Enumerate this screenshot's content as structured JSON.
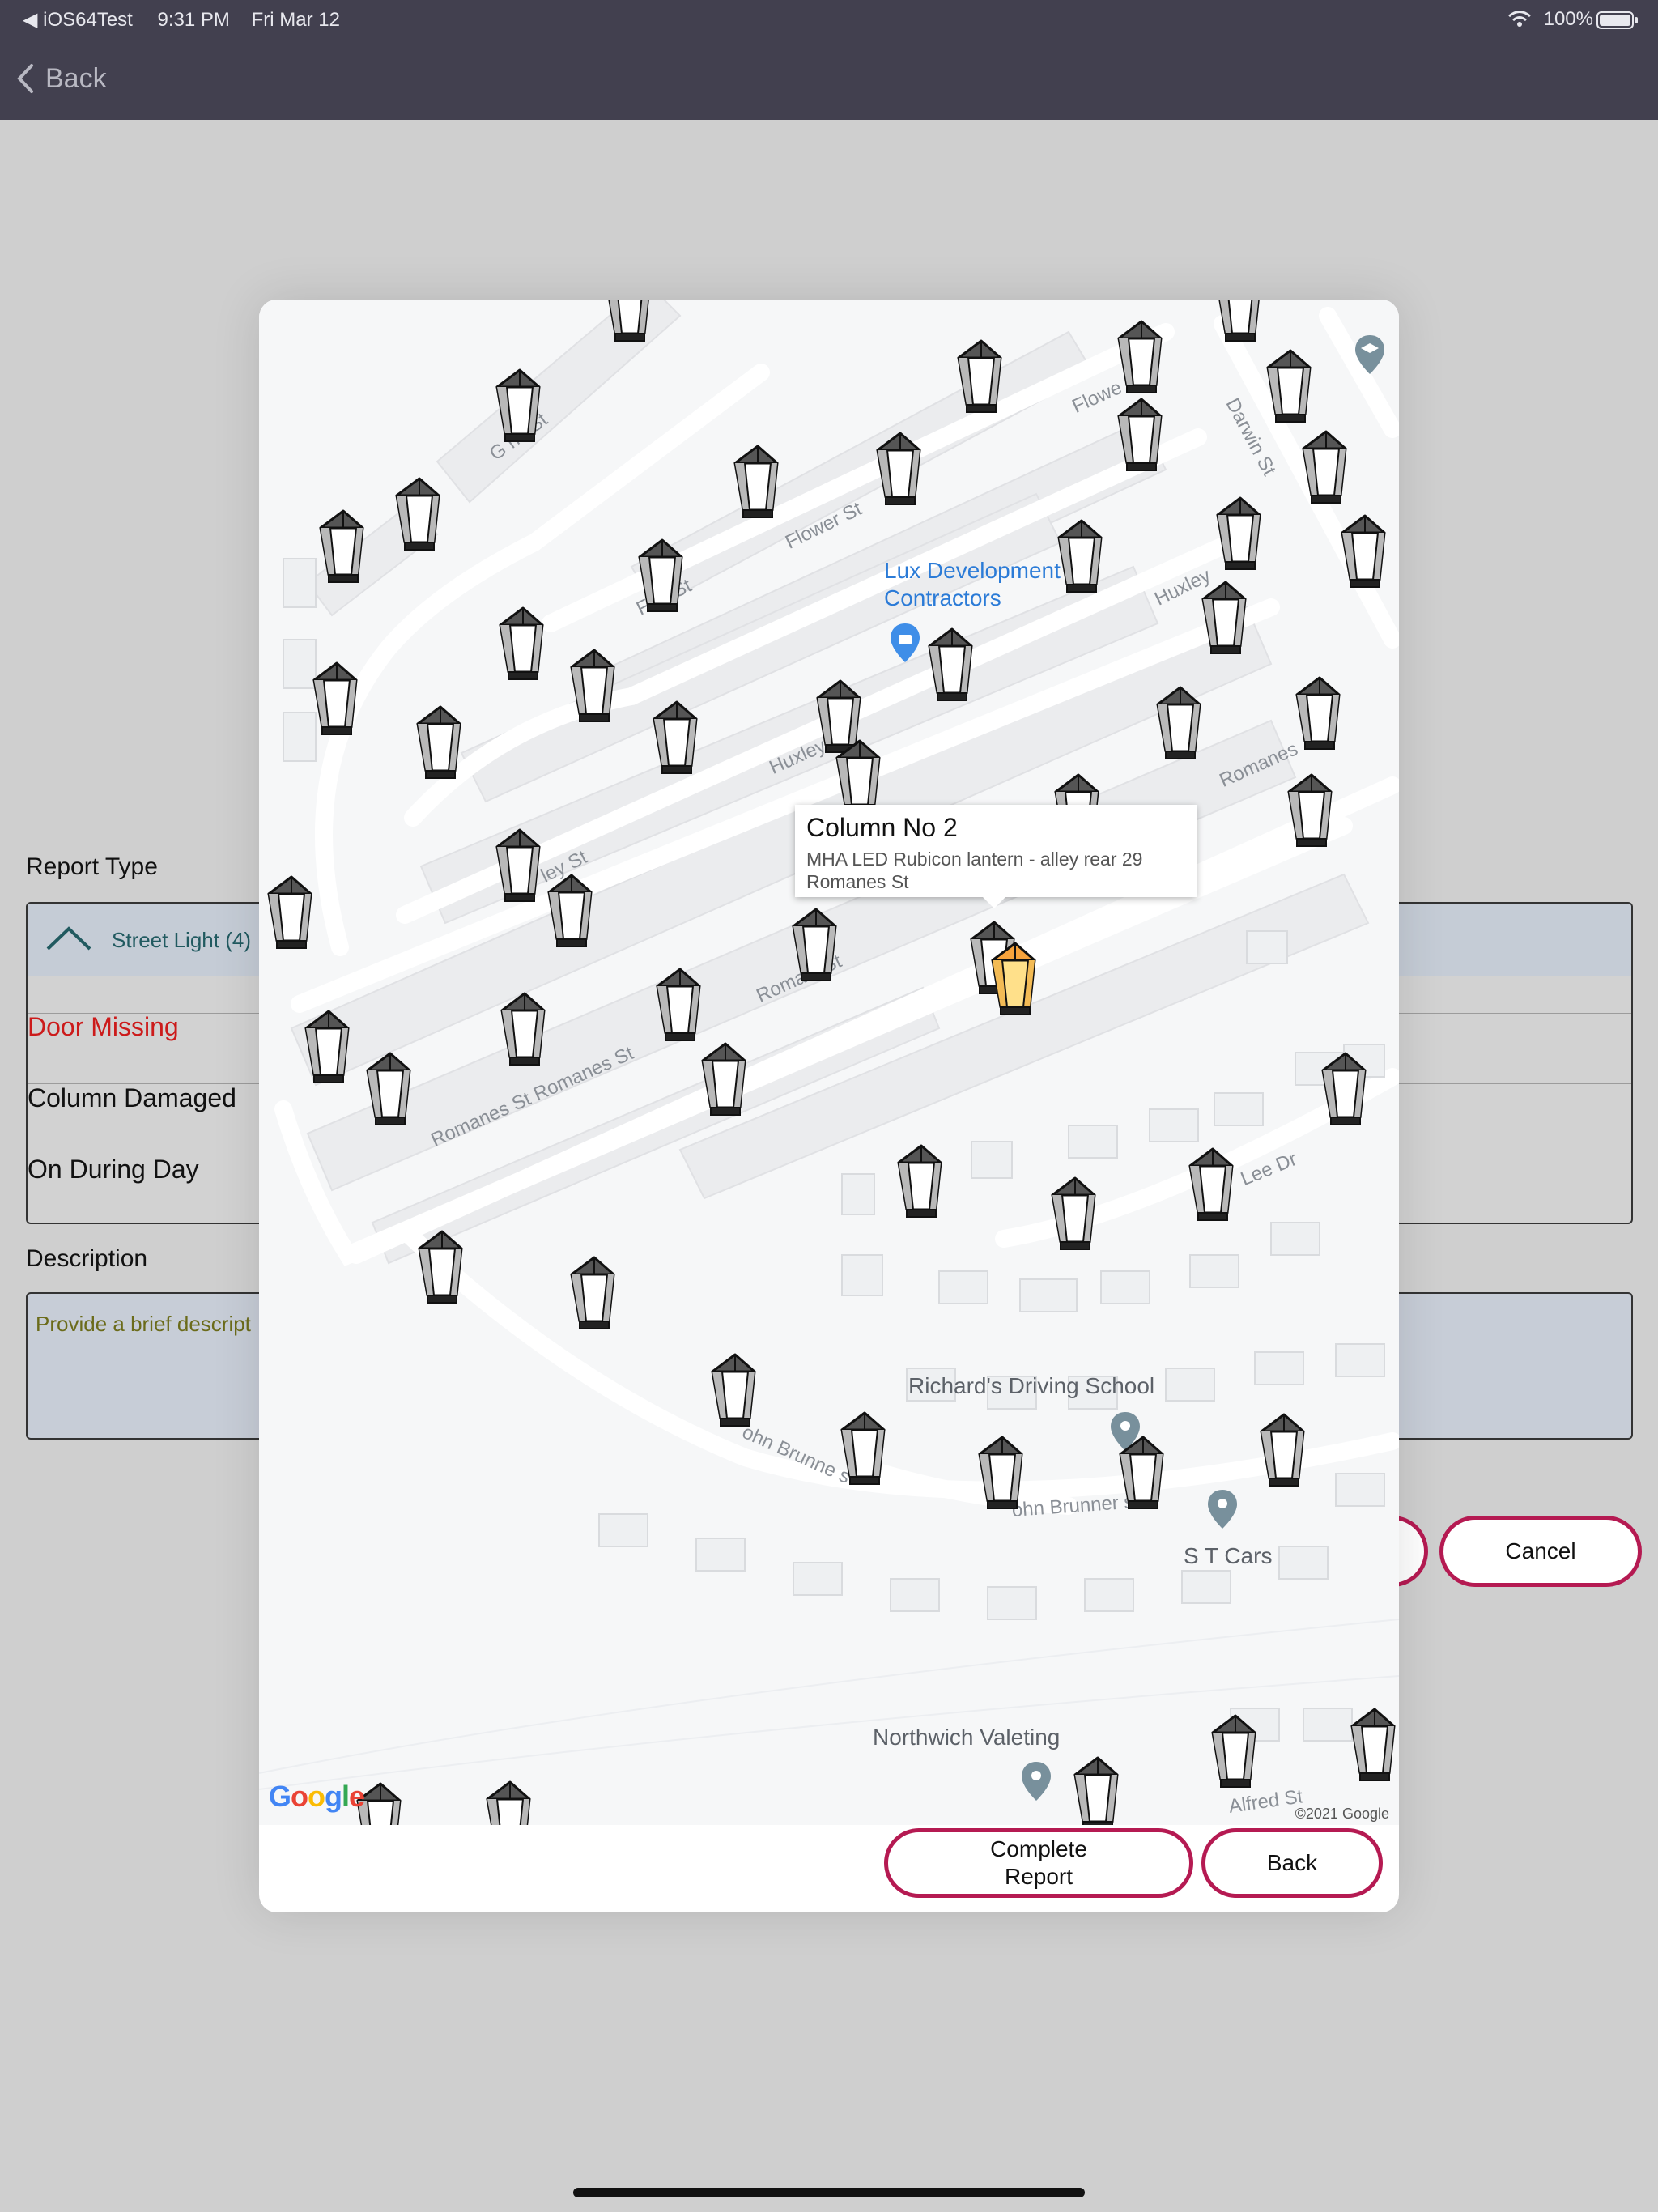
{
  "status_bar": {
    "back_app": "◀ iOS64Test",
    "time": "9:31 PM",
    "date": "Fri Mar 12",
    "battery": "100%",
    "battery_level": 1.0
  },
  "nav": {
    "back_label": "Back"
  },
  "form": {
    "report_type_label": "Report Type",
    "report_type_value": "Street Light (4)",
    "options": [
      "Door Missing",
      "Column Damaged",
      "On During Day"
    ],
    "description_label": "Description",
    "description_placeholder": "Provide a brief descript",
    "cancel_label": "Cancel"
  },
  "modal": {
    "popup_title": "Column No 2",
    "popup_subtitle_line1": "MHA LED Rubicon lantern - alley rear 29",
    "popup_subtitle_line2": "Romanes St",
    "complete_label_line1": "Complete",
    "complete_label_line2": "Report",
    "back_label": "Back"
  },
  "map": {
    "google_logo": "Google",
    "copyright": "©2021 Google",
    "pois": {
      "lux_line1": "Lux Development",
      "lux_line2": "Contractors",
      "driving_school": "Richard's Driving School",
      "st_cars": "S T Cars",
      "valeting": "Northwich Valeting"
    },
    "streets": {
      "flower_st_1": "Flower St",
      "flower_st_2": "Flowe",
      "flower_st_3": "F    er St",
      "darwin_st": "Darwin St",
      "huxley_1": "Huxley",
      "huxley_2": "Huxley",
      "romanes_1": "Romanes",
      "romanes_2": "Roma   s St",
      "romanes_3": "Romanes St Romanes St",
      "lee_dr": "Lee Dr",
      "john_brunner_1": "ohn Brunne   s",
      "john_brunner_2": "ohn Brunner   s",
      "alfred_st": "Alfred St",
      "g_st": "G       ne St",
      "ley_st": "ley St"
    }
  }
}
